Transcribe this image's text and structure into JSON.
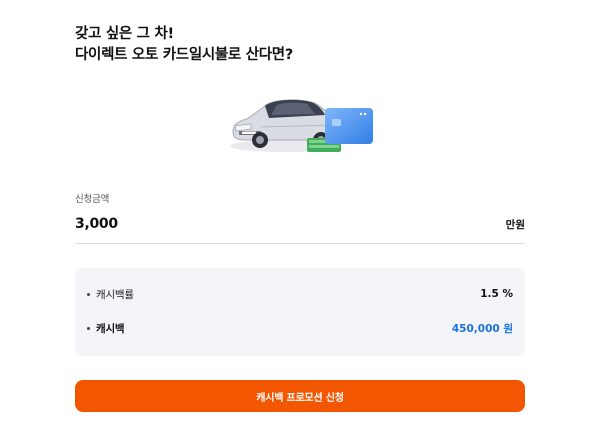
{
  "headline": {
    "line1": "갖고 싶은 그 차!",
    "line2": "다이렉트 오토 카드일시불로 산다면?"
  },
  "hero": {
    "icon": "car-with-card-and-cash-illustration"
  },
  "application": {
    "label": "신청금액",
    "value": "3,000",
    "unit": "만원"
  },
  "summary": {
    "rows": [
      {
        "label": "캐시백률",
        "value": "1.5 %"
      },
      {
        "label": "캐시백",
        "value": "450,000 원"
      }
    ]
  },
  "cta": {
    "label": "캐시백 프로모션 신청"
  },
  "colors": {
    "accent": "#f25600",
    "highlight": "#1a73d9",
    "panel": "#f4f5f9"
  }
}
